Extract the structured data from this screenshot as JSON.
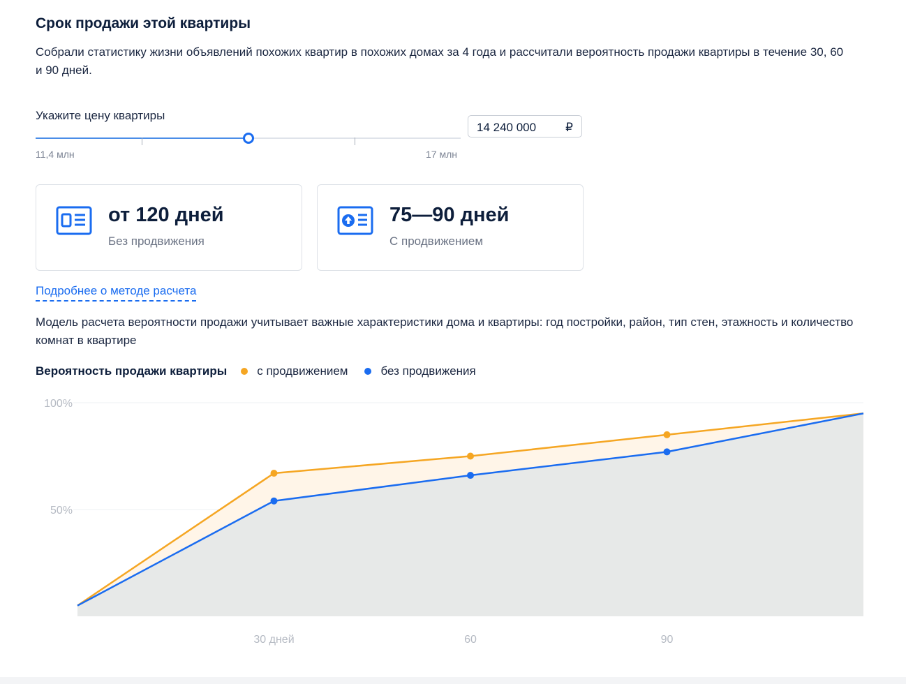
{
  "header": {
    "title": "Срок продажи этой квартиры",
    "description": "Собрали статистику жизни объявлений похожих квартир в похожих домах за 4 года и рассчитали вероятность продажи квартиры в течение 30, 60 и 90 дней."
  },
  "price": {
    "label": "Укажите цену квартиры",
    "slider_min": "11,4 млн",
    "slider_max": "17 млн",
    "slider_position": 0.5,
    "input_value": "14 240 000",
    "currency": "₽"
  },
  "cards": [
    {
      "title": "от 120 дней",
      "subtitle": "Без продвижения",
      "icon": "listing-icon"
    },
    {
      "title": "75—90 дней",
      "subtitle": "С продвижением",
      "icon": "listing-boost-icon"
    }
  ],
  "method_link": "Подробнее о методе расчета",
  "model_text": "Модель расчета вероятности продажи учитывает важные характеристики дома и квартиры: год постройки, район, тип стен, этажность и количество комнат в квартире",
  "legend": {
    "title": "Вероятность продажи квартиры",
    "with_promo": "с продвижением",
    "without_promo": "без продвижения"
  },
  "colors": {
    "accent": "#1a6cf0",
    "with_promo": "#f5a623",
    "without_promo": "#1a6cf0",
    "area": "#e7e9e8",
    "area_promo": "#fff5e8"
  },
  "chart_data": {
    "type": "area",
    "x": [
      0,
      30,
      60,
      90,
      120
    ],
    "x_tick_labels": [
      {
        "x": 30,
        "label": "30 дней"
      },
      {
        "x": 60,
        "label": "60"
      },
      {
        "x": 90,
        "label": "90"
      }
    ],
    "xlim": [
      0,
      120
    ],
    "ylim": [
      0,
      100
    ],
    "y_ticks": [
      {
        "value": 50,
        "label": "50%"
      },
      {
        "value": 100,
        "label": "100%"
      }
    ],
    "series": [
      {
        "name": "с продвижением",
        "values": [
          5,
          67,
          75,
          85,
          95
        ],
        "markers": [
          false,
          true,
          true,
          true,
          false
        ]
      },
      {
        "name": "без продвижения",
        "values": [
          5,
          54,
          66,
          77,
          95
        ],
        "markers": [
          false,
          true,
          true,
          true,
          false
        ]
      }
    ],
    "grid": true
  }
}
